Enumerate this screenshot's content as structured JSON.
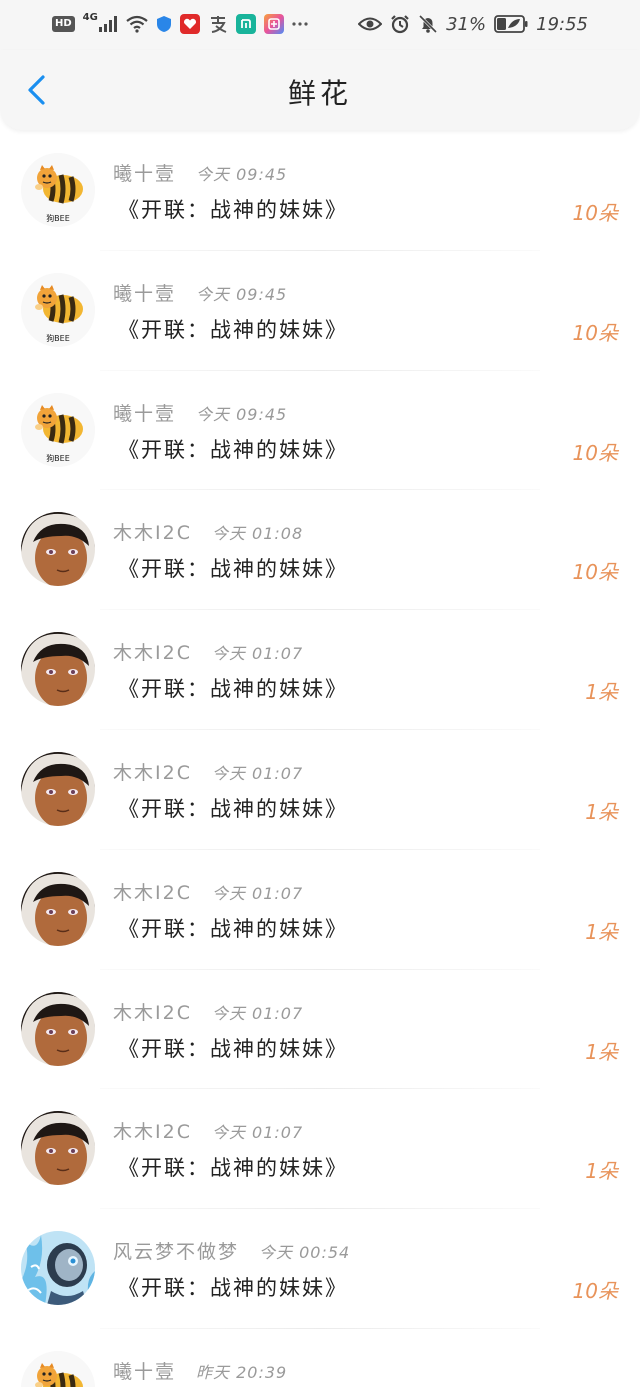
{
  "status_bar": {
    "hd": "HD",
    "network": "4G",
    "battery_percent": "31%",
    "time": "19:55"
  },
  "header": {
    "title": "鲜花",
    "back_icon": "chevron-left-icon",
    "accent_color": "#1a8ff0"
  },
  "colors": {
    "count": "#e8935a",
    "meta": "#9a9a9a",
    "text": "#222222"
  },
  "items": [
    {
      "name": "曦十壹",
      "time": "今天 09:45",
      "book": "《开联：战神的妹妹》",
      "count": "10朵",
      "avatar": "bee-avatar",
      "avatar_caption": "狗BEE"
    },
    {
      "name": "曦十壹",
      "time": "今天 09:45",
      "book": "《开联：战神的妹妹》",
      "count": "10朵",
      "avatar": "bee-avatar",
      "avatar_caption": "狗BEE"
    },
    {
      "name": "曦十壹",
      "time": "今天 09:45",
      "book": "《开联：战神的妹妹》",
      "count": "10朵",
      "avatar": "bee-avatar",
      "avatar_caption": "狗BEE"
    },
    {
      "name": "木木I2C",
      "time": "今天 01:08",
      "book": "《开联：战神的妹妹》",
      "count": "10朵",
      "avatar": "anime-boy-avatar"
    },
    {
      "name": "木木I2C",
      "time": "今天 01:07",
      "book": "《开联：战神的妹妹》",
      "count": "1朵",
      "avatar": "anime-boy-avatar"
    },
    {
      "name": "木木I2C",
      "time": "今天 01:07",
      "book": "《开联：战神的妹妹》",
      "count": "1朵",
      "avatar": "anime-boy-avatar"
    },
    {
      "name": "木木I2C",
      "time": "今天 01:07",
      "book": "《开联：战神的妹妹》",
      "count": "1朵",
      "avatar": "anime-boy-avatar"
    },
    {
      "name": "木木I2C",
      "time": "今天 01:07",
      "book": "《开联：战神的妹妹》",
      "count": "1朵",
      "avatar": "anime-boy-avatar"
    },
    {
      "name": "木木I2C",
      "time": "今天 01:07",
      "book": "《开联：战神的妹妹》",
      "count": "1朵",
      "avatar": "anime-boy-avatar"
    },
    {
      "name": "风云梦不做梦",
      "time": "今天 00:54",
      "book": "《开联：战神的妹妹》",
      "count": "10朵",
      "avatar": "robot-avatar"
    },
    {
      "name": "曦十壹",
      "time": "昨天 20:39",
      "book": "",
      "count": "",
      "avatar": "bee-avatar",
      "avatar_caption": ""
    }
  ]
}
